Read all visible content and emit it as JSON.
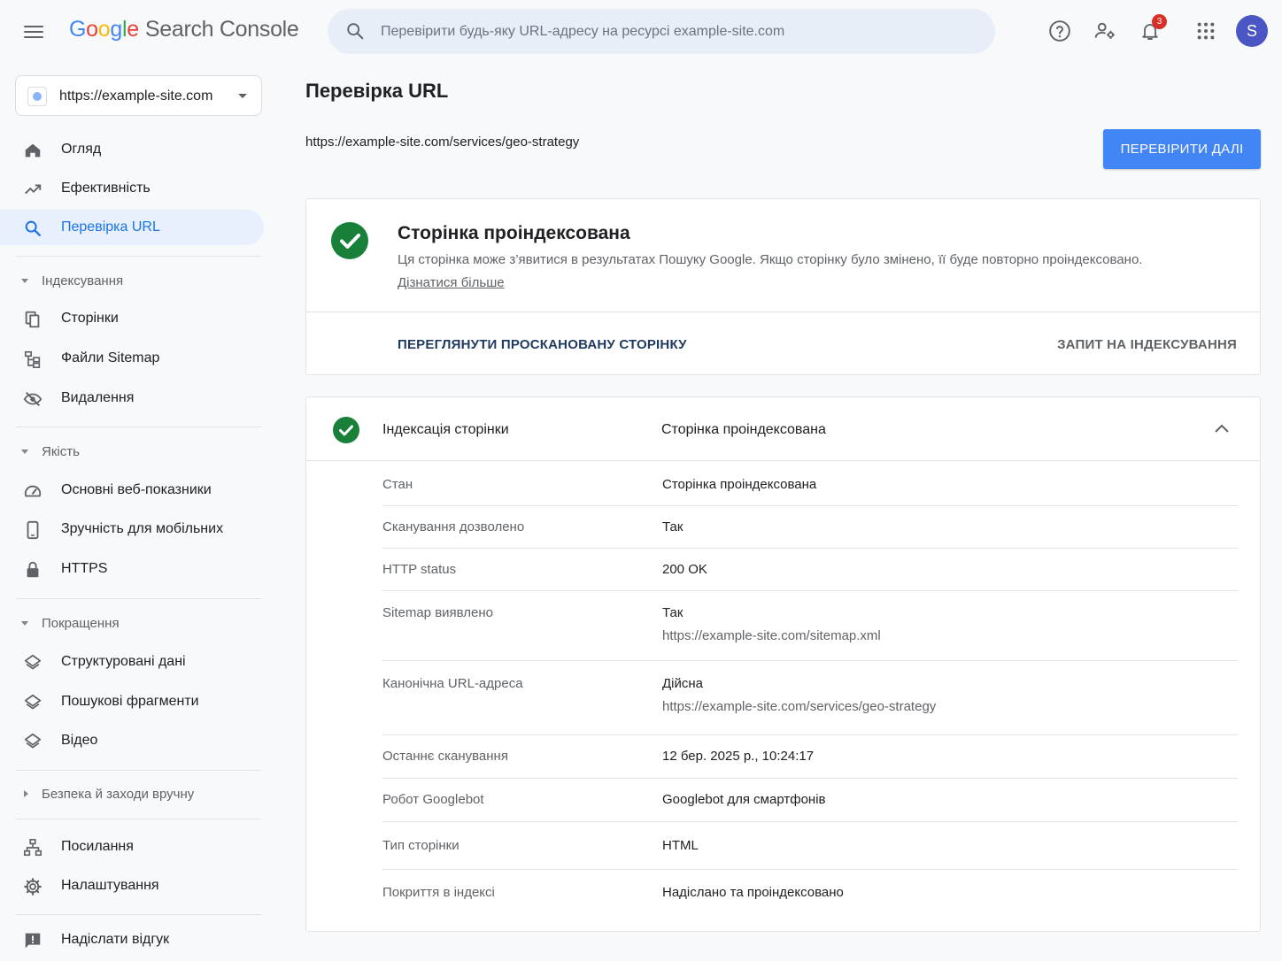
{
  "header": {
    "logo_letters": [
      "G",
      "o",
      "o",
      "g",
      "l",
      "e"
    ],
    "product_name": "Search Console",
    "search_placeholder": "Перевірити будь-яку URL-адресу на ресурсі example-site.com",
    "notification_count": "3",
    "avatar_letter": "S",
    "icons": [
      "menu-icon",
      "search-icon",
      "help-icon",
      "manage-users-icon",
      "notifications-icon",
      "apps-icon"
    ]
  },
  "sidebar": {
    "property": "https://example-site.com",
    "top_items": [
      {
        "label": "Огляд",
        "icon": "home-icon"
      },
      {
        "label": "Ефективність",
        "icon": "trending-up-icon"
      },
      {
        "label": "Перевірка URL",
        "icon": "search-icon",
        "active": true
      }
    ],
    "sections": [
      {
        "title": "Індексування",
        "expanded": true,
        "items": [
          {
            "label": "Сторінки",
            "icon": "pages-icon"
          },
          {
            "label": "Файли Sitemap",
            "icon": "sitemap-icon"
          },
          {
            "label": "Видалення",
            "icon": "removals-icon"
          }
        ]
      },
      {
        "title": "Якість",
        "expanded": true,
        "items": [
          {
            "label": "Основні веб-показники",
            "icon": "speed-gauge-icon"
          },
          {
            "label": "Зручність для мобільних",
            "icon": "smartphone-icon"
          },
          {
            "label": "HTTPS",
            "icon": "lock-icon"
          }
        ]
      },
      {
        "title": "Покращення",
        "expanded": true,
        "items": [
          {
            "label": "Структуровані дані",
            "icon": "layers-icon"
          },
          {
            "label": "Пошукові фрагменти",
            "icon": "layers-icon"
          },
          {
            "label": "Відео",
            "icon": "layers-icon"
          }
        ]
      },
      {
        "title": "Безпека й заходи вручну",
        "expanded": false,
        "items": []
      }
    ],
    "bottom_items": [
      {
        "label": "Посилання",
        "icon": "links-icon"
      },
      {
        "label": "Налаштування",
        "icon": "settings-gear-icon"
      },
      {
        "label": "Надіслати відгук",
        "icon": "feedback-icon"
      }
    ]
  },
  "main": {
    "title": "Перевірка URL",
    "inspected_url": "https://example-site.com/services/geo-strategy",
    "inspect_button": "ПЕРЕВІРИТИ ДАЛІ",
    "status": {
      "title": "Сторінка проіндексована",
      "description": "Ця сторінка може з’явитися в результатах Пошуку Google. Якщо сторінку було змінено, її буде повторно проіндексовано.",
      "learn_more": "Дізнатися більше",
      "view_crawled": "ПЕРЕГЛЯНУТИ ПРОСКАНОВАНУ СТОРІНКУ",
      "request_indexing": "ЗАПИТ НА ІНДЕКСУВАННЯ",
      "color": "#188038"
    },
    "indexing": {
      "label": "Індексація сторінки",
      "value": "Сторінка проіндексована",
      "rows": [
        {
          "key": "Стан",
          "value": "Сторінка проіндексована"
        },
        {
          "key": "Сканування дозволено",
          "value": "Так"
        },
        {
          "key": "HTTP status",
          "value": "200 OK"
        },
        {
          "key": "Sitemap виявлено",
          "value": "Так",
          "sub": "https://example-site.com/sitemap.xml"
        },
        {
          "key": "Канонічна URL-адреса",
          "value": "Дійсна",
          "sub": "https://example-site.com/services/geo-strategy"
        },
        {
          "key": "Останнє сканування",
          "value": "12 бер. 2025 р., 10:24:17"
        },
        {
          "key": "Робот Googlebot",
          "value": "Googlebot для смартфонів"
        },
        {
          "key": "Тип сторінки",
          "value": "HTML"
        },
        {
          "key": "Покриття в індексі",
          "value": "Надіслано та проіндексовано"
        }
      ]
    }
  },
  "colors": {
    "primary": "#4285f4",
    "active_nav_bg": "#e8f0fe",
    "active_nav_text": "#1a73e8",
    "success": "#188038",
    "badge": "#d93025",
    "avatar": "#4a56c4"
  }
}
